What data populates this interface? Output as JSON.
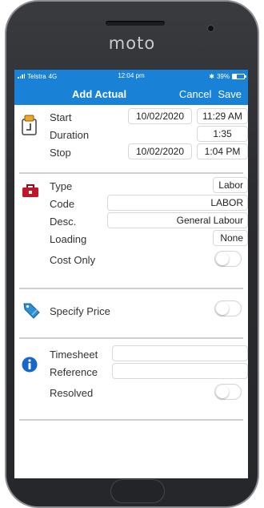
{
  "device": {
    "brand": "moto"
  },
  "statusbar": {
    "carrier": "Telstra",
    "network": "4G",
    "time": "12:04 pm",
    "bluetooth": "✱",
    "battery": "39%",
    "battery_level": 0.39
  },
  "nav": {
    "title": "Add Actual",
    "cancel": "Cancel",
    "save": "Save"
  },
  "time_section": {
    "icon": "clipboard-calendar-icon",
    "start_label": "Start",
    "start_date": "10/02/2020",
    "start_time": "11:29 AM",
    "duration_label": "Duration",
    "duration": "1:35",
    "stop_label": "Stop",
    "stop_date": "10/02/2020",
    "stop_time": "1:04 PM"
  },
  "type_section": {
    "icon": "toolbox-icon",
    "type_label": "Type",
    "type_value": "Labor",
    "code_label": "Code",
    "code_value": "LABOR",
    "desc_label": "Desc.",
    "desc_value": "General Labour",
    "loading_label": "Loading",
    "loading_value": "None",
    "cost_only_label": "Cost Only",
    "cost_only": false
  },
  "price_section": {
    "icon": "price-tag-icon",
    "label": "Specify Price",
    "enabled": false
  },
  "info_section": {
    "icon": "info-icon",
    "timesheet_label": "Timesheet",
    "timesheet_value": "",
    "reference_label": "Reference",
    "reference_value": "",
    "resolved_label": "Resolved",
    "resolved": false
  },
  "colors": {
    "accent": "#1a82d6",
    "icon_red": "#c0182a",
    "info_blue": "#1668c9"
  }
}
